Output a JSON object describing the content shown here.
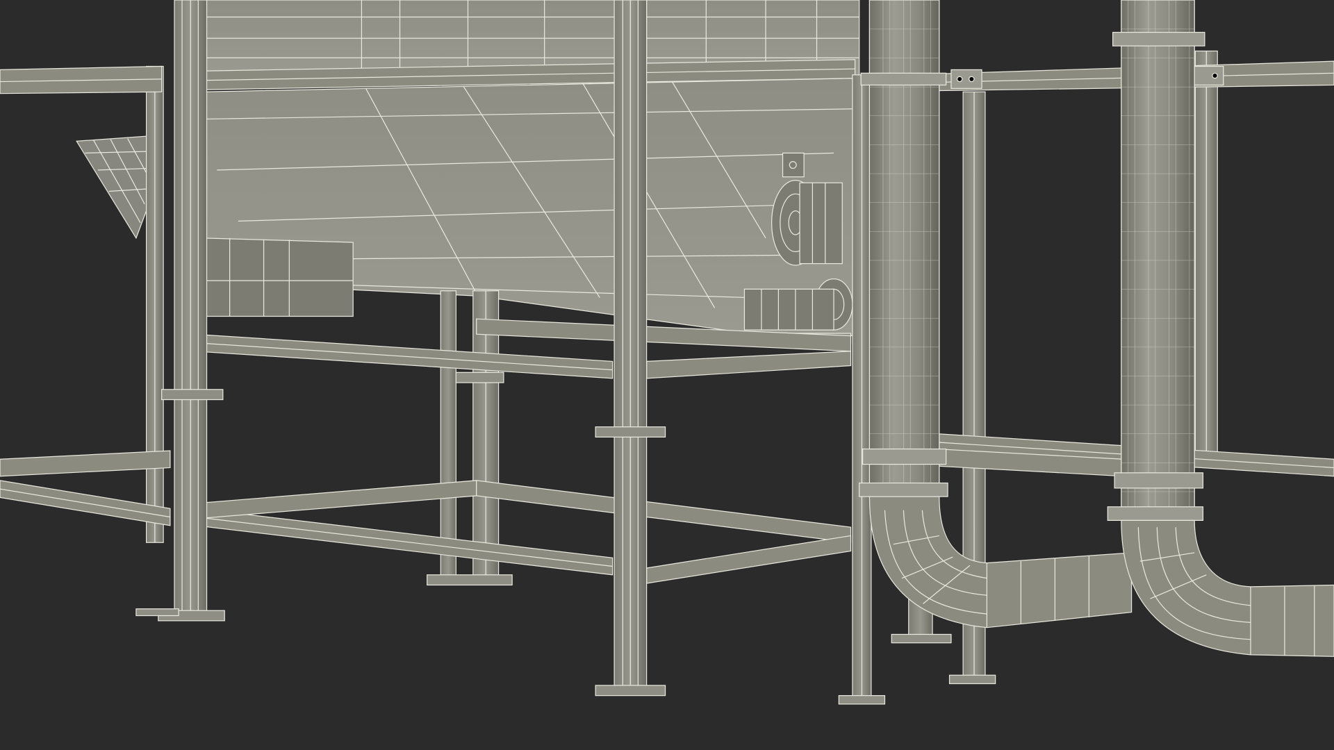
{
  "scene": {
    "description_visible_text": "",
    "colors": {
      "background": "#2b2b2b",
      "surface": "#8b8b80",
      "surface_light": "#a4a49a",
      "surface_dark": "#6f6f66",
      "wire": "#e8e8de"
    },
    "objects": [
      {
        "name": "hopper-bin",
        "kind": "inclined-trough"
      },
      {
        "name": "support-frame",
        "kind": "steel-frame"
      },
      {
        "name": "vertical-pipe-left",
        "kind": "pipe"
      },
      {
        "name": "vertical-pipe-right",
        "kind": "pipe"
      },
      {
        "name": "pipe-elbow-left",
        "kind": "pipe-bend"
      },
      {
        "name": "pipe-elbow-right",
        "kind": "pipe-bend"
      },
      {
        "name": "motor-gearbox",
        "kind": "drive-unit"
      },
      {
        "name": "side-chute",
        "kind": "inclined-chute"
      }
    ]
  }
}
